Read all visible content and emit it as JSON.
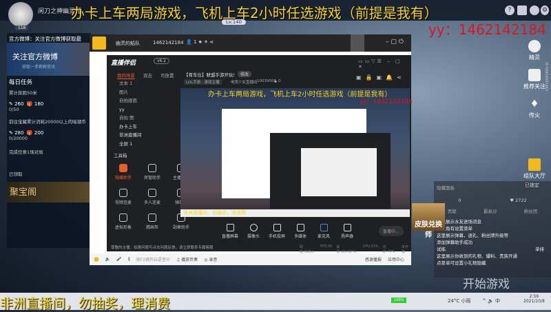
{
  "stream_overlay": {
    "top_banner": "办卡上车两局游戏，飞机上车2小时任选游戏（前提是我有）",
    "yy_id": "yy：1462142184",
    "bottom_banner": "非洲直播间，勿抽奖，理消费",
    "start_game": "开始游戏"
  },
  "game_header": {
    "player_name": "闲刀之神幽灵哥",
    "avatar_level": "116",
    "level_badge": "Lv.140"
  },
  "left_panel": {
    "weibo_title": "官方微博：关注官方微博获取最",
    "weibo_banner": "关注官方微博",
    "weibo_sub": "获取一手新鲜资讯",
    "daily_title": "每日任务",
    "tasks": [
      {
        "desc": "累计奔跑50米",
        "reward1": "260",
        "reward2": "180",
        "progress": "0/50"
      },
      {
        "desc": "前往宝藏累计消耗20000以上的暗潮币",
        "reward1": "280",
        "reward2": "200",
        "progress": "0/20000"
      },
      {
        "desc": "完成任意1场对局",
        "status": "已领取"
      }
    ],
    "treasure": "聚宝阁"
  },
  "yy_window": {
    "channel_name": "幽灵的船队",
    "channel_id": "1462142184",
    "online": "1",
    "bottom_toolbar": {
      "input_placeholder": "按F2键开启语音中",
      "music": "播放伴奏",
      "record": "录音",
      "emotion": "感谢播报",
      "app_center": "应用中心",
      "trial": "试练"
    }
  },
  "app": {
    "title": "直播伴侣",
    "version": "v6.2",
    "tabs": [
      "我的场景",
      "双击",
      "可放置"
    ],
    "layers": [
      "文本 1",
      "图片",
      "自拍画面",
      "yy",
      "自拍 图",
      "办卡上车",
      "非洲直播间",
      "全屏 1"
    ],
    "toolbox_title": "工具箱",
    "tools": [
      "隐藏助手",
      "房管助手",
      "主播任务",
      "视频连麦",
      "多人连麦",
      "弹幕墙",
      "虚拟形象",
      "猜画布",
      "勋章助手"
    ],
    "stream_title": "【有车位】联盟手游开玩!",
    "stream_edit": "修改",
    "category": "LOL手游 · 游戏主播",
    "channel_info": "电竞少女直播间",
    "room_id": "10039500",
    "heat": "0",
    "bottom_controls": [
      "直播屏幕",
      "摄像头",
      "手机投屏",
      "多媒体",
      "麦克风",
      "扬声器"
    ],
    "live_button": "直播中...",
    "status_text": "尊敬的主播，如遇问题可点击问题反馈，请立即联系专属客服",
    "stats": [
      "网络:0KB/s",
      "FPS:30",
      "丢帧:0(0.00%)",
      "CPU:25%",
      "内存:70%",
      "未开播"
    ]
  },
  "right_sidebar": {
    "items": [
      "精灵",
      "推荐关注",
      "传火",
      "组队大厅"
    ],
    "locked": "已锁定",
    "vid": "ID:50616001063"
  },
  "chat": {
    "header": "隐藏面板",
    "count1": "0",
    "likes": "2722",
    "tabs": [
      "贡献",
      "最高分",
      "粉丝团"
    ],
    "messages": [
      "这里展示水友进场消息",
      "右上角有设置菜单",
      "这里展示弹幕，送礼、粉丝牌升级等",
      "添加弹幕助手成功",
      "这里展示你收到的礼物、爆料、贵族开通",
      "点菜单可设置小礼物隐藏"
    ],
    "promo": "皮肤兑换师",
    "rank": "单排"
  },
  "taskbar": {
    "battery": "100%",
    "weather": "24°C 小雨",
    "ime": "中",
    "time": "2:59",
    "date": "2021/10/8"
  }
}
